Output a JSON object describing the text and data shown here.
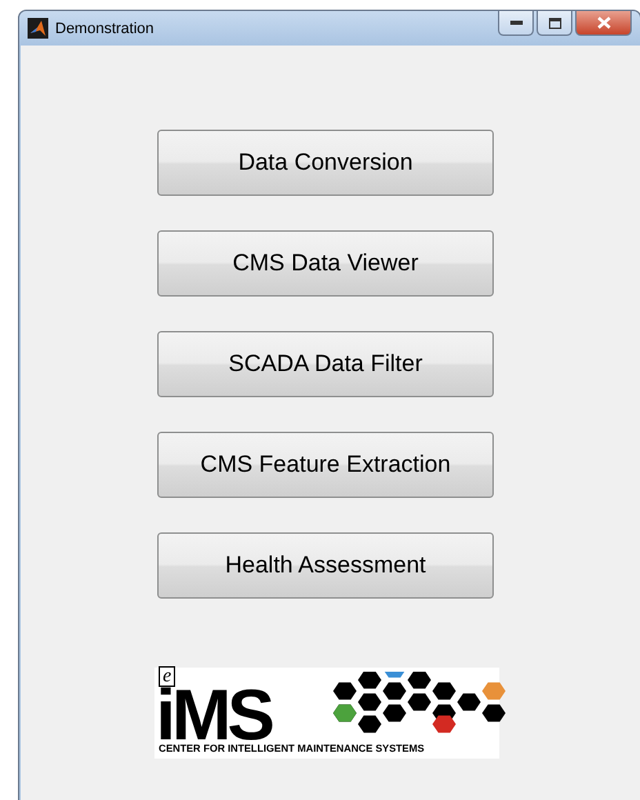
{
  "window": {
    "title": "Demonstration"
  },
  "buttons": [
    {
      "label": "Data Conversion"
    },
    {
      "label": "CMS Data Viewer"
    },
    {
      "label": "SCADA Data Filter"
    },
    {
      "label": "CMS Feature Extraction"
    },
    {
      "label": "Health Assessment"
    }
  ],
  "logo": {
    "prefix": "e",
    "name": "iMS",
    "tagline": "CENTER FOR INTELLIGENT MAINTENANCE SYSTEMS"
  }
}
